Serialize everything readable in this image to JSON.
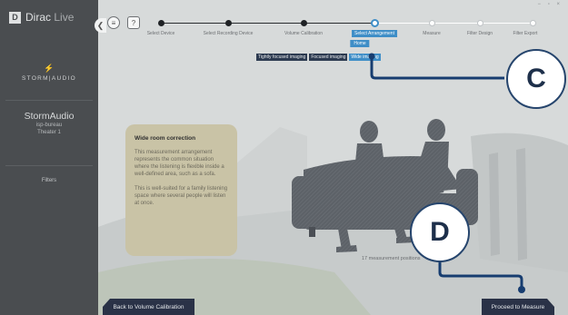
{
  "app": {
    "brand_name": "Dirac",
    "brand_suffix": "Live",
    "logo_letter": "D"
  },
  "sidebar": {
    "collapse_icon": "chevron-left-icon",
    "partner_logo_text": "STORM|AUDIO",
    "device_name": "StormAudio",
    "device_line1": "isp-bureau",
    "device_line2": "Theater 1",
    "filters_label": "Filters"
  },
  "toolbar": {
    "menu_icon": "≡",
    "help_label": "?"
  },
  "window_controls": "− ▫ ×",
  "steps": [
    {
      "label": "Select Device",
      "state": "done"
    },
    {
      "label": "Select Recording Device",
      "state": "done"
    },
    {
      "label": "Volume Calibration",
      "state": "done"
    },
    {
      "label": "Select Arrangement",
      "state": "active"
    },
    {
      "label": "Measure",
      "state": "todo"
    },
    {
      "label": "Filter Design",
      "state": "todo"
    },
    {
      "label": "Filter Export",
      "state": "todo"
    }
  ],
  "arrangement": {
    "mode_tag": "Home",
    "options": [
      {
        "label": "Tightly focused imaging",
        "selected": false
      },
      {
        "label": "Focused imaging",
        "selected": false
      },
      {
        "label": "Wide imaging",
        "selected": true
      }
    ]
  },
  "info_card": {
    "title": "Wide room correction",
    "para1": "This measurement arrangement represents the common situation where the listening is flexible inside a well-defined area, such as a sofa.",
    "para2": "This is well-suited for a family listening space where several people will listen at once."
  },
  "measurement_count": "17 measurement positions",
  "buttons": {
    "back": "Back to Volume Calibration",
    "proceed": "Proceed to Measure"
  },
  "callouts": {
    "c": "C",
    "d": "D"
  },
  "colors": {
    "accent": "#3f8ec7",
    "callout_line": "#173d70",
    "dark_button": "#2a3247",
    "sidebar": "#4a4d50",
    "info_card": "#c9c3a6"
  }
}
